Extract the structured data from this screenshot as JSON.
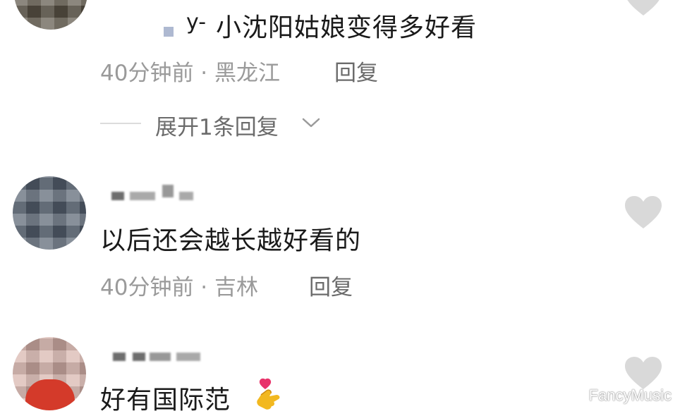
{
  "comments": [
    {
      "username_tail": "y-",
      "text": "小沈阳姑娘变得多好看",
      "time_location": "40分钟前 · 黑龙江",
      "reply_label": "回复",
      "expand_label": "展开1条回复"
    },
    {
      "text": "以后还会越长越好看的",
      "time_location": "40分钟前 · 吉林",
      "reply_label": "回复"
    },
    {
      "text": "好有国际范"
    }
  ],
  "watermark": "FancyMusic",
  "colors": {
    "heart": "#d9d9d9",
    "meta": "#9a9a9a",
    "text": "#1a1a1a"
  },
  "icons": [
    "heart-icon",
    "chevron-down-icon",
    "finger-heart-emoji"
  ]
}
